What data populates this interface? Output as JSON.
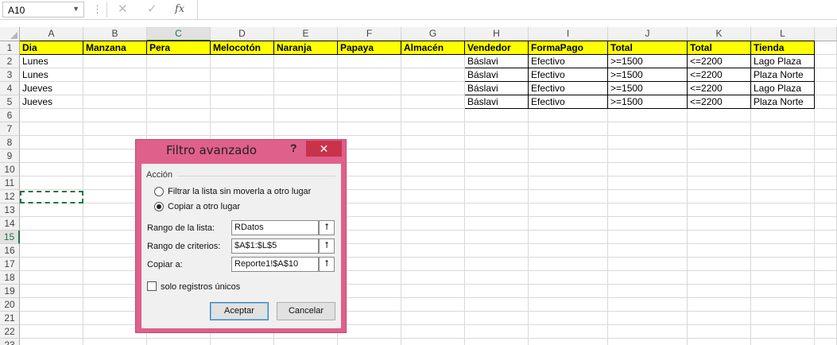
{
  "formula_bar": {
    "name_box": "A10",
    "fx": "fx",
    "cancel_glyph": "✕",
    "enter_glyph": "✓",
    "dots": "⋮",
    "value": ""
  },
  "columns": [
    "A",
    "B",
    "C",
    "D",
    "E",
    "F",
    "G",
    "H",
    "I",
    "J",
    "K",
    "L"
  ],
  "selected_column": "C",
  "rows": [
    "1",
    "2",
    "3",
    "4",
    "5",
    "6",
    "7",
    "8",
    "9",
    "10",
    "11",
    "12",
    "13",
    "14",
    "15",
    "16",
    "17",
    "18",
    "19",
    "20",
    "21",
    "22",
    "23"
  ],
  "selected_row": "15",
  "sheet": {
    "headers": [
      "Dia",
      "Manzana",
      "Pera",
      "Melocotón",
      "Naranja",
      "Papaya",
      "Almacén",
      "Vendedor",
      "FormaPago",
      "Total",
      "Total",
      "Tienda"
    ],
    "data": [
      [
        "Lunes",
        "",
        "",
        "",
        "",
        "",
        "",
        "Báslavi",
        "Efectivo",
        ">=1500",
        "<=2200",
        "Lago Plaza"
      ],
      [
        "Lunes",
        "",
        "",
        "",
        "",
        "",
        "",
        "Báslavi",
        "Efectivo",
        ">=1500",
        "<=2200",
        "Plaza Norte"
      ],
      [
        "Jueves",
        "",
        "",
        "",
        "",
        "",
        "",
        "Báslavi",
        "Efectivo",
        ">=1500",
        "<=2200",
        "Lago Plaza"
      ],
      [
        "Jueves",
        "",
        "",
        "",
        "",
        "",
        "",
        "Báslavi",
        "Efectivo",
        ">=1500",
        "<=2200",
        "Plaza Norte"
      ]
    ]
  },
  "dialog": {
    "title": "Filtro avanzado",
    "help": "?",
    "close": "✕",
    "group_label": "Acción",
    "option_filter": "Filtrar la lista sin moverla a otro lugar",
    "option_copy": "Copiar a otro lugar",
    "selected_option": "copy",
    "list_range_label": "Rango de la lista:",
    "list_range_value": "RDatos",
    "criteria_range_label": "Rango de criterios:",
    "criteria_range_value": "$A$1:$L$5",
    "copy_to_label": "Copiar a:",
    "copy_to_value": "Reporte1!$A$10",
    "collapse_glyph": "⭡",
    "unique_label": "solo registros únicos",
    "unique_checked": false,
    "ok_label": "Aceptar",
    "cancel_label": "Cancelar"
  },
  "colors": {
    "dialog_frame": "#e0608c",
    "close_button": "#c9334a",
    "header_fill": "#ffff00",
    "selection_green": "#217346"
  }
}
